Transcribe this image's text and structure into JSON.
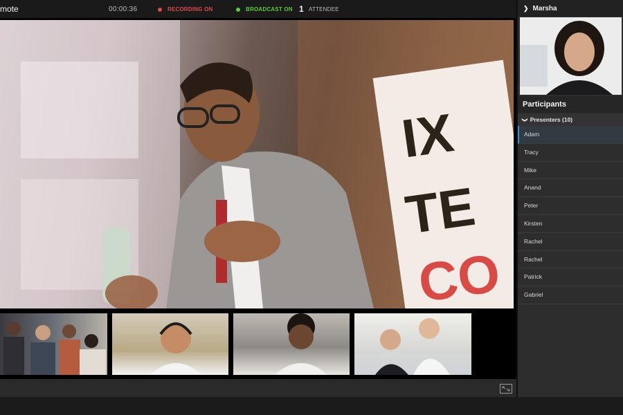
{
  "topbar": {
    "app_title": "mote",
    "timer": "00:00:36",
    "recording": "RECORDING ON",
    "broadcast": "BROADCAST ON",
    "attendee_count": "1",
    "attendee_label": "ATTENDEE"
  },
  "colors": {
    "recording": "#e0474c",
    "broadcast": "#5ccb2f",
    "active_accent": "#3e8bd6"
  },
  "sidebar": {
    "self_name": "Marsha",
    "participants_title": "Participants",
    "group_label": "Presenters (10)",
    "participants": [
      "Adam",
      "Tracy",
      "Mike",
      "Anand",
      "Peter",
      "Kirsten",
      "Rachel",
      "Rachel",
      "Patrick",
      "Gabriel"
    ],
    "active_participant_index": 0
  },
  "stage": {
    "banner_text": "IX TEC CO"
  },
  "icons": {
    "expand": "expand-icon",
    "chevron_right": "chevron-right-icon",
    "chevron_down": "chevron-down-icon"
  }
}
